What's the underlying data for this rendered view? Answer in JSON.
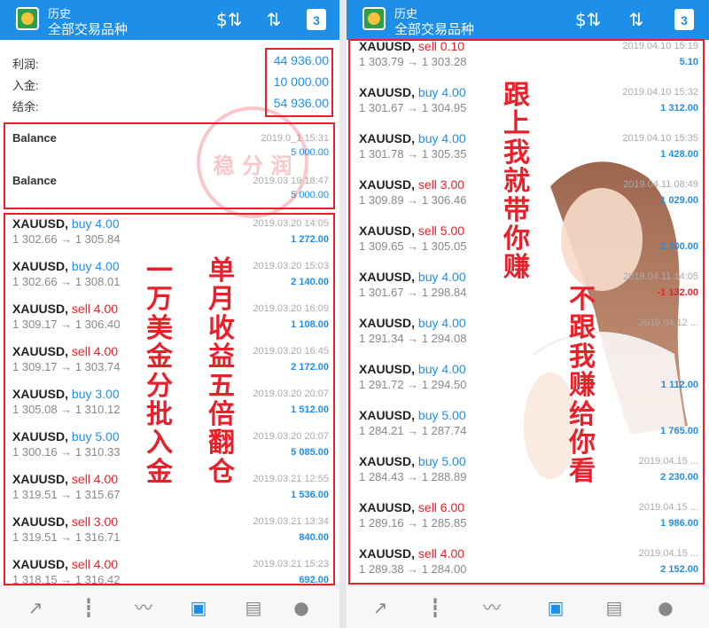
{
  "appbar": {
    "title": "历史",
    "subtitle": "全部交易品种",
    "icons": [
      "currency-sort-icon",
      "sort-icon",
      "calendar-icon"
    ],
    "calendar_day": "3"
  },
  "left": {
    "summary": [
      {
        "label": "利润:",
        "value": "44 936.00"
      },
      {
        "label": "入金:",
        "value": "10 000.00"
      },
      {
        "label": "结余:",
        "value": "54 936.00"
      }
    ],
    "balances": [
      {
        "label": "Balance",
        "date": "2019.0_1 15:31",
        "amount": "5 000.00"
      },
      {
        "label": "Balance",
        "date": "2019.03 19 18:47",
        "amount": "5 000.00"
      }
    ],
    "trades": [
      {
        "symbol": "XAUUSD,",
        "side": "buy 4.00",
        "type": "buy",
        "prices": "1 302.66 → 1 305.84",
        "date": "2019.03.20 14:05",
        "profit": "1 272.00"
      },
      {
        "symbol": "XAUUSD,",
        "side": "buy 4.00",
        "type": "buy",
        "prices": "1 302.66 → 1 308.01",
        "date": "2019.03.20 15:03",
        "profit": "2 140.00"
      },
      {
        "symbol": "XAUUSD,",
        "side": "sell 4.00",
        "type": "sell",
        "prices": "1 309.17 → 1 306.40",
        "date": "2019.03.20 16:09",
        "profit": "1 108.00"
      },
      {
        "symbol": "XAUUSD,",
        "side": "sell 4.00",
        "type": "sell",
        "prices": "1 309.17 → 1 303.74",
        "date": "2019.03.20 16:45",
        "profit": "2 172.00"
      },
      {
        "symbol": "XAUUSD,",
        "side": "buy 3.00",
        "type": "buy",
        "prices": "1 305.08 → 1 310.12",
        "date": "2019.03.20 20:07",
        "profit": "1 512.00"
      },
      {
        "symbol": "XAUUSD,",
        "side": "buy 5.00",
        "type": "buy",
        "prices": "1 300.16 → 1 310.33",
        "date": "2019.03.20 20:07",
        "profit": "5 085.00"
      },
      {
        "symbol": "XAUUSD,",
        "side": "sell 4.00",
        "type": "sell",
        "prices": "1 319.51 → 1 315.67",
        "date": "2019.03.21 12:55",
        "profit": "1 536.00"
      },
      {
        "symbol": "XAUUSD,",
        "side": "sell 3.00",
        "type": "sell",
        "prices": "1 319.51 → 1 316.71",
        "date": "2019.03.21 13:34",
        "profit": "840.00"
      },
      {
        "symbol": "XAUUSD,",
        "side": "sell 4.00",
        "type": "sell",
        "prices": "1 318.15 → 1 316.42",
        "date": "2019.03.21 15:23",
        "profit": "692.00"
      }
    ],
    "overlay_col1": [
      "一",
      "万",
      "美",
      "金",
      "分",
      "批",
      "入",
      "金"
    ],
    "overlay_col2": [
      "单",
      "月",
      "收",
      "益",
      "五",
      "倍",
      "翻",
      "仓"
    ],
    "stamp_text": "稳 分 润"
  },
  "right": {
    "trades": [
      {
        "symbol": "XAUUSD,",
        "side": "sell 0.10",
        "type": "sell",
        "prices": "1 303.79 → 1 303.28",
        "date": "2019.04.10 15:19",
        "profit": "5.10"
      },
      {
        "symbol": "XAUUSD,",
        "side": "buy 4.00",
        "type": "buy",
        "prices": "1 301.67 → 1 304.95",
        "date": "2019.04.10 15:32",
        "profit": "1 312.00"
      },
      {
        "symbol": "XAUUSD,",
        "side": "buy 4.00",
        "type": "buy",
        "prices": "1 301.78 → 1 305.35",
        "date": "2019.04.10 15:35",
        "profit": "1 428.00"
      },
      {
        "symbol": "XAUUSD,",
        "side": "sell 3.00",
        "type": "sell",
        "prices": "1 309.89 → 1 306.46",
        "date": "2019.04.11 08:49",
        "profit": "1 029.00"
      },
      {
        "symbol": "XAUUSD,",
        "side": "sell 5.00",
        "type": "sell",
        "prices": "1 309.65 → 1 305.05",
        "date": "",
        "profit": "2 300.00"
      },
      {
        "symbol": "XAUUSD,",
        "side": "buy 4.00",
        "type": "buy",
        "prices": "1 301.67 → 1 298.84",
        "date": "2019.04.11 14:05",
        "profit": "-1 132.00"
      },
      {
        "symbol": "XAUUSD,",
        "side": "buy 4.00",
        "type": "buy",
        "prices": "1 291.34 → 1 294.08",
        "date": "2019.04.12 ...",
        "profit": ""
      },
      {
        "symbol": "XAUUSD,",
        "side": "buy 4.00",
        "type": "buy",
        "prices": "1 291.72 → 1 294.50",
        "date": "",
        "profit": "1 112.00"
      },
      {
        "symbol": "XAUUSD,",
        "side": "buy 5.00",
        "type": "buy",
        "prices": "1 284.21 → 1 287.74",
        "date": "",
        "profit": "1 765.00"
      },
      {
        "symbol": "XAUUSD,",
        "side": "buy 5.00",
        "type": "buy",
        "prices": "1 284.43 → 1 288.89",
        "date": "2019.04.15 ...",
        "profit": "2 230.00"
      },
      {
        "symbol": "XAUUSD,",
        "side": "sell 6.00",
        "type": "sell",
        "prices": "1 289.16 → 1 285.85",
        "date": "2019.04.15 ...",
        "profit": "1 986.00"
      },
      {
        "symbol": "XAUUSD,",
        "side": "sell 4.00",
        "type": "sell",
        "prices": "1 289.38 → 1 284.00",
        "date": "2019.04.15 ...",
        "profit": "2 152.00"
      }
    ],
    "overlay_col1": [
      "跟",
      "上",
      "我",
      "就",
      "带",
      "你",
      "赚"
    ],
    "overlay_col2": [
      "不",
      "跟",
      "我",
      "赚",
      "给",
      "你",
      "看"
    ]
  },
  "bottomnav": [
    "trade-icon",
    "chart-candles-icon",
    "line-chart-icon",
    "history-inbox-icon",
    "news-icon",
    "chat-icon"
  ],
  "colors": {
    "accent": "#1e8fe8",
    "loss": "#e8202a",
    "box": "#e8202a"
  }
}
